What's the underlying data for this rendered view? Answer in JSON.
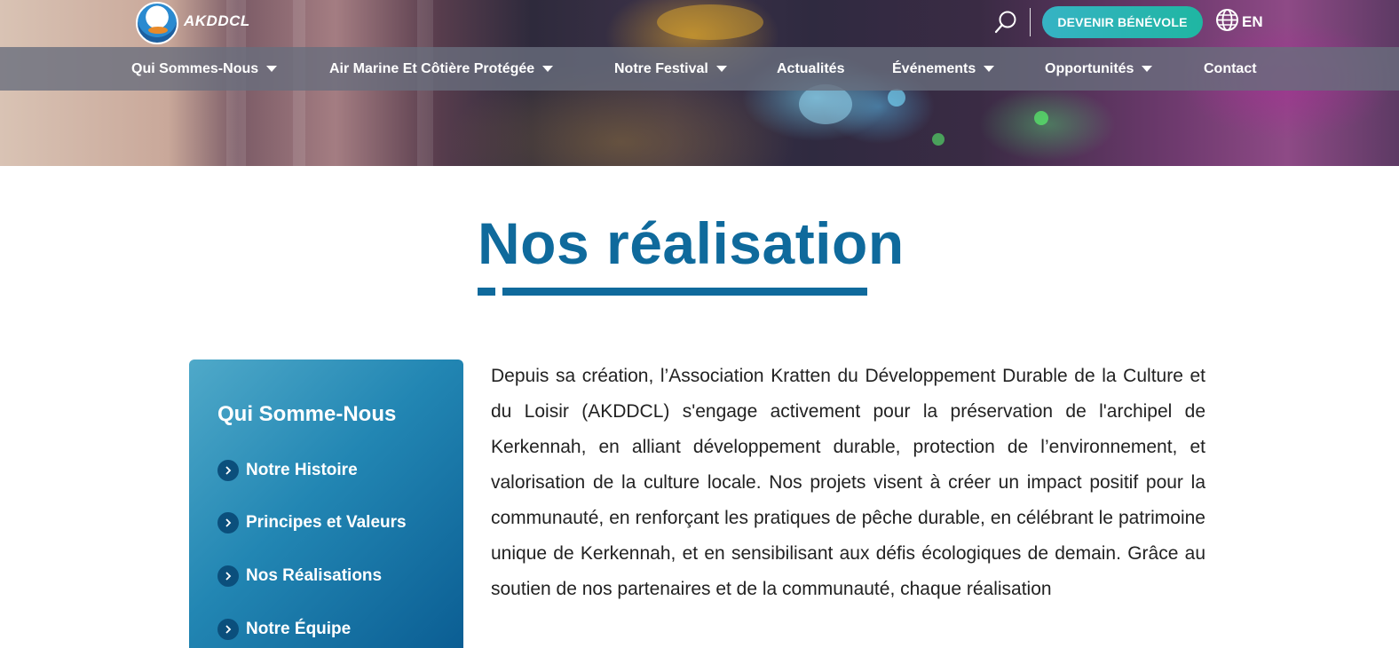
{
  "header": {
    "logo_text": "AKDDCL",
    "volunteer_button": "DEVENIR BÉNÉVOLE",
    "language": "EN",
    "icons": [
      "search-icon",
      "globe-icon"
    ]
  },
  "nav": {
    "items": [
      {
        "label": "Qui Sommes-Nous",
        "dropdown": true
      },
      {
        "label": "Air Marine Et Côtière Protégée",
        "dropdown": true
      },
      {
        "label": "Notre Festival",
        "dropdown": true
      },
      {
        "label": "Actualités",
        "dropdown": false
      },
      {
        "label": "Événements",
        "dropdown": true
      },
      {
        "label": "Opportunités",
        "dropdown": true
      },
      {
        "label": "Contact",
        "dropdown": false
      }
    ]
  },
  "main": {
    "title": "Nos réalisation",
    "accent_color": "#0f6a9c",
    "sidebar": {
      "title": "Qui Somme-Nous",
      "items": [
        {
          "label": "Notre Histoire"
        },
        {
          "label": "Principes et Valeurs"
        },
        {
          "label": "Nos Réalisations"
        },
        {
          "label": "Notre Équipe"
        }
      ]
    },
    "paragraph": "Depuis sa création, l’Association Kratten du Développement Durable de la Culture et du Loisir (AKDDCL) s'engage activement pour la préservation de l'archipel de Kerkennah, en alliant développement durable, protection de l’environnement, et valorisation de la culture locale. Nos projets visent à créer un impact positif pour la communauté, en renforçant les pratiques de pêche durable, en célébrant le patrimoine unique de Kerkennah, et en sensibilisant aux défis écologiques de demain. Grâce au soutien de nos partenaires et de la communauté, chaque réalisation"
  }
}
